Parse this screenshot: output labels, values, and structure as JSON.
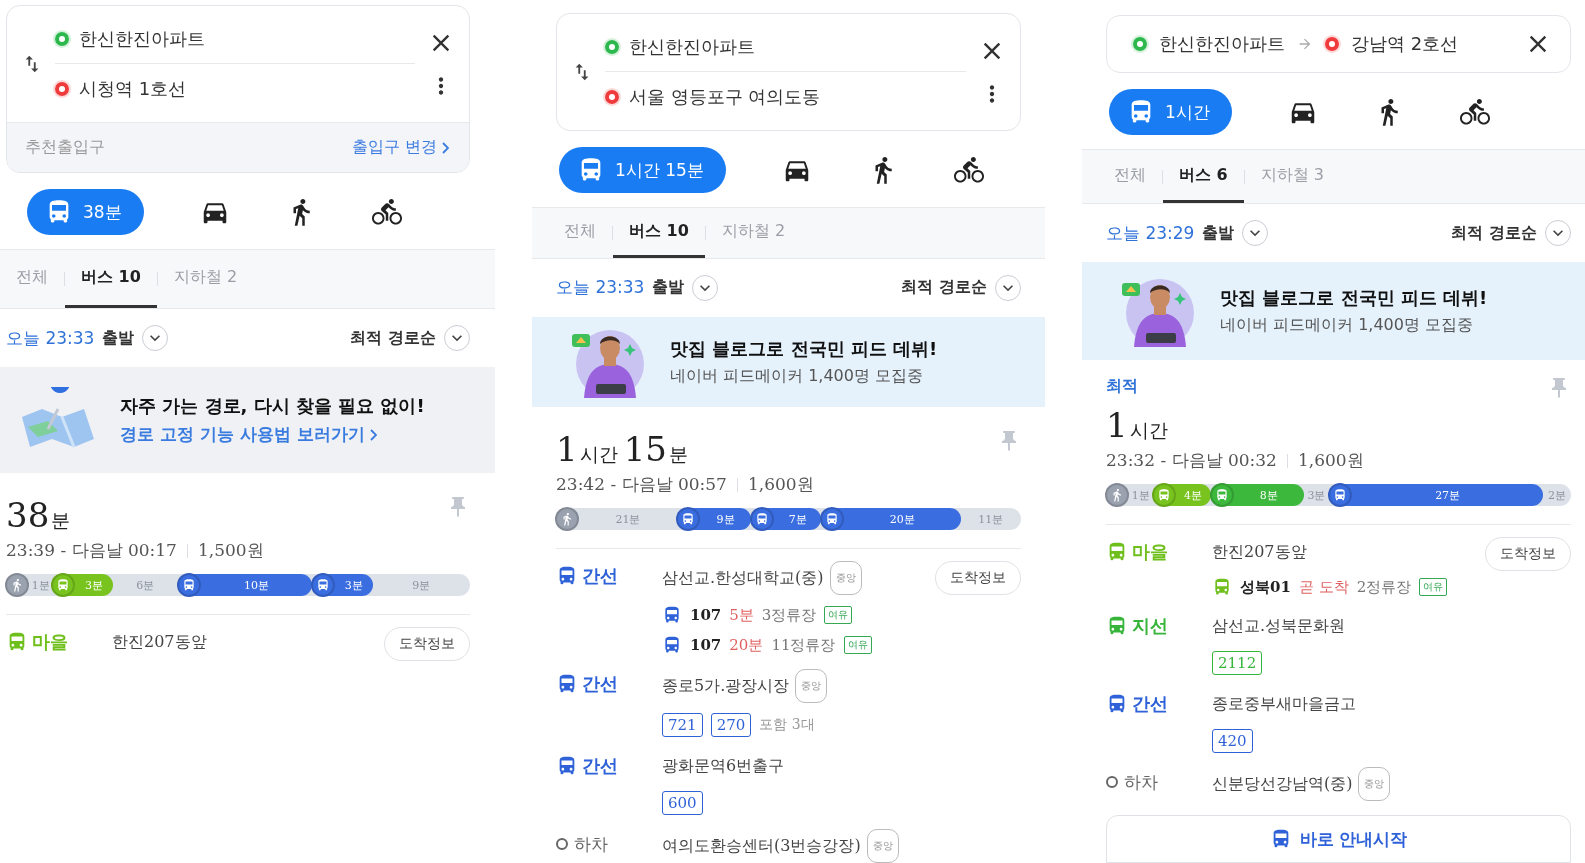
{
  "panels": [
    {
      "header": {
        "kind": "stacked",
        "origin": "한신한진아파트",
        "destination": "시청역 1호선",
        "entrance": {
          "label": "추천출입구",
          "action": "출입구 변경"
        }
      },
      "modes": [
        {
          "kind": "transit",
          "label": "38분",
          "selected": true
        },
        {
          "kind": "car",
          "selected": false
        },
        {
          "kind": "walk",
          "selected": false
        },
        {
          "kind": "bike",
          "selected": false
        }
      ],
      "tabs": [
        {
          "label": "전체",
          "selected": false
        },
        {
          "label": "버스 10",
          "selected": true
        },
        {
          "label": "지하철 2",
          "selected": false
        }
      ],
      "departure": {
        "time": "오늘 23:33",
        "action": "출발"
      },
      "sort": "최적 경로순",
      "banner": {
        "kind": "tip",
        "title": "자주 가는 경로, 다시 찾을 필요 없이!",
        "link": "경로 고정 기능 사용법 보러가기"
      },
      "route": {
        "duration": [
          {
            "value": "38",
            "unit": "분"
          }
        ],
        "times": "23:39 - 다음날 00:17",
        "fare": "1,500원",
        "segments": [
          {
            "kind": "walk",
            "label": "1분"
          },
          {
            "kind": "bus",
            "label": "3분",
            "color": "#78c31e"
          },
          {
            "kind": "gap",
            "label": "6분"
          },
          {
            "kind": "bus",
            "label": "10분",
            "color": "#3a6de0"
          },
          {
            "kind": "bus",
            "label": "3분",
            "color": "#3a6de0"
          },
          {
            "kind": "gap",
            "label": "9분"
          }
        ],
        "steps": [
          {
            "kind": "board",
            "type": "마을",
            "color": "#6fbf1c",
            "stop": "한진207동앞",
            "action": "도착정보"
          }
        ]
      }
    },
    {
      "header": {
        "kind": "stacked",
        "origin": "한신한진아파트",
        "destination": "서울 영등포구 여의도동"
      },
      "modes": [
        {
          "kind": "transit",
          "label": "1시간 15분",
          "selected": true
        },
        {
          "kind": "car",
          "selected": false
        },
        {
          "kind": "walk",
          "selected": false
        },
        {
          "kind": "bike",
          "selected": false
        }
      ],
      "tabs": [
        {
          "label": "전체",
          "selected": false
        },
        {
          "label": "버스 10",
          "selected": true
        },
        {
          "label": "지하철 2",
          "selected": false
        }
      ],
      "departure": {
        "time": "오늘 23:33",
        "action": "출발"
      },
      "sort": "최적 경로순",
      "banner": {
        "kind": "promo",
        "title": "맛집 블로그로 전국민 피드 데뷔!",
        "subtitle": "네이버 피드메이커 1,400명 모집중"
      },
      "route": {
        "duration": [
          {
            "value": "1",
            "unit": "시간"
          },
          {
            "value": "15",
            "unit": "분"
          }
        ],
        "times": "23:42 - 다음날 00:57",
        "fare": "1,600원",
        "segments": [
          {
            "kind": "walk",
            "label": "21분"
          },
          {
            "kind": "bus",
            "label": "9분",
            "color": "#3a6de0"
          },
          {
            "kind": "bus",
            "label": "7분",
            "color": "#3a6de0"
          },
          {
            "kind": "bus",
            "label": "20분",
            "color": "#3a6de0"
          },
          {
            "kind": "gap",
            "label": "11분"
          }
        ],
        "steps": [
          {
            "kind": "board",
            "type": "간선",
            "color": "#2f62d8",
            "stop": "삼선교.한성대학교(중)",
            "tag": "중앙",
            "action": "도착정보",
            "arrivals": [
              {
                "bus": "107",
                "eta": "5분",
                "stops": "3정류장",
                "crowd": "여유"
              },
              {
                "bus": "107",
                "eta": "20분",
                "stops": "11정류장",
                "crowd": "여유"
              }
            ]
          },
          {
            "kind": "board",
            "type": "간선",
            "color": "#2f62d8",
            "stop": "종로5가.광장시장",
            "tag": "중앙",
            "routes": [
              "721",
              "270"
            ],
            "routes_note": "포함 3대"
          },
          {
            "kind": "board",
            "type": "간선",
            "color": "#2f62d8",
            "stop": "광화문역6번출구",
            "routes": [
              "600"
            ]
          },
          {
            "kind": "alight",
            "type": "하차",
            "stop": "여의도환승센터(3번승강장)",
            "tag": "중앙"
          }
        ]
      }
    },
    {
      "header": {
        "kind": "inline",
        "origin": "한신한진아파트",
        "destination": "강남역 2호선"
      },
      "modes": [
        {
          "kind": "transit",
          "label": "1시간",
          "selected": true
        },
        {
          "kind": "car",
          "selected": false
        },
        {
          "kind": "walk",
          "selected": false
        },
        {
          "kind": "bike",
          "selected": false
        }
      ],
      "tabs": [
        {
          "label": "전체",
          "selected": false
        },
        {
          "label": "버스 6",
          "selected": true
        },
        {
          "label": "지하철 3",
          "selected": false
        }
      ],
      "departure": {
        "time": "오늘 23:29",
        "action": "출발"
      },
      "sort": "최적 경로순",
      "banner": {
        "kind": "promo",
        "title": "맛집 블로그로 전국민 피드 데뷔!",
        "subtitle": "네이버 피드메이커 1,400명 모집중"
      },
      "route": {
        "badge": "최적",
        "duration": [
          {
            "value": "1",
            "unit": "시간"
          }
        ],
        "times": "23:32 - 다음날 00:32",
        "fare": "1,600원",
        "segments": [
          {
            "kind": "walk",
            "label": "1분"
          },
          {
            "kind": "bus",
            "label": "4분",
            "color": "#78c31e"
          },
          {
            "kind": "bus",
            "label": "8분",
            "color": "#3cb83c"
          },
          {
            "kind": "gap",
            "label": "3분"
          },
          {
            "kind": "bus",
            "label": "27분",
            "color": "#3a6de0"
          },
          {
            "kind": "gap",
            "label": "2분"
          }
        ],
        "steps": [
          {
            "kind": "board",
            "type": "마을",
            "color": "#6fbf1c",
            "stop": "한진207동앞",
            "action": "도착정보",
            "arrivals": [
              {
                "bus": "성북01",
                "eta": "곧 도착",
                "stops": "2정류장",
                "crowd": "여유"
              }
            ]
          },
          {
            "kind": "board",
            "type": "지선",
            "color": "#36b53a",
            "stop": "삼선교.성북문화원",
            "routes": [
              "2112"
            ]
          },
          {
            "kind": "board",
            "type": "간선",
            "color": "#2f62d8",
            "stop": "종로중부새마을금고",
            "routes": [
              "420"
            ]
          },
          {
            "kind": "alight",
            "type": "하차",
            "stop": "신분당선강남역(중)",
            "tag": "중앙"
          }
        ],
        "start_button": "바로 안내시작"
      }
    }
  ]
}
